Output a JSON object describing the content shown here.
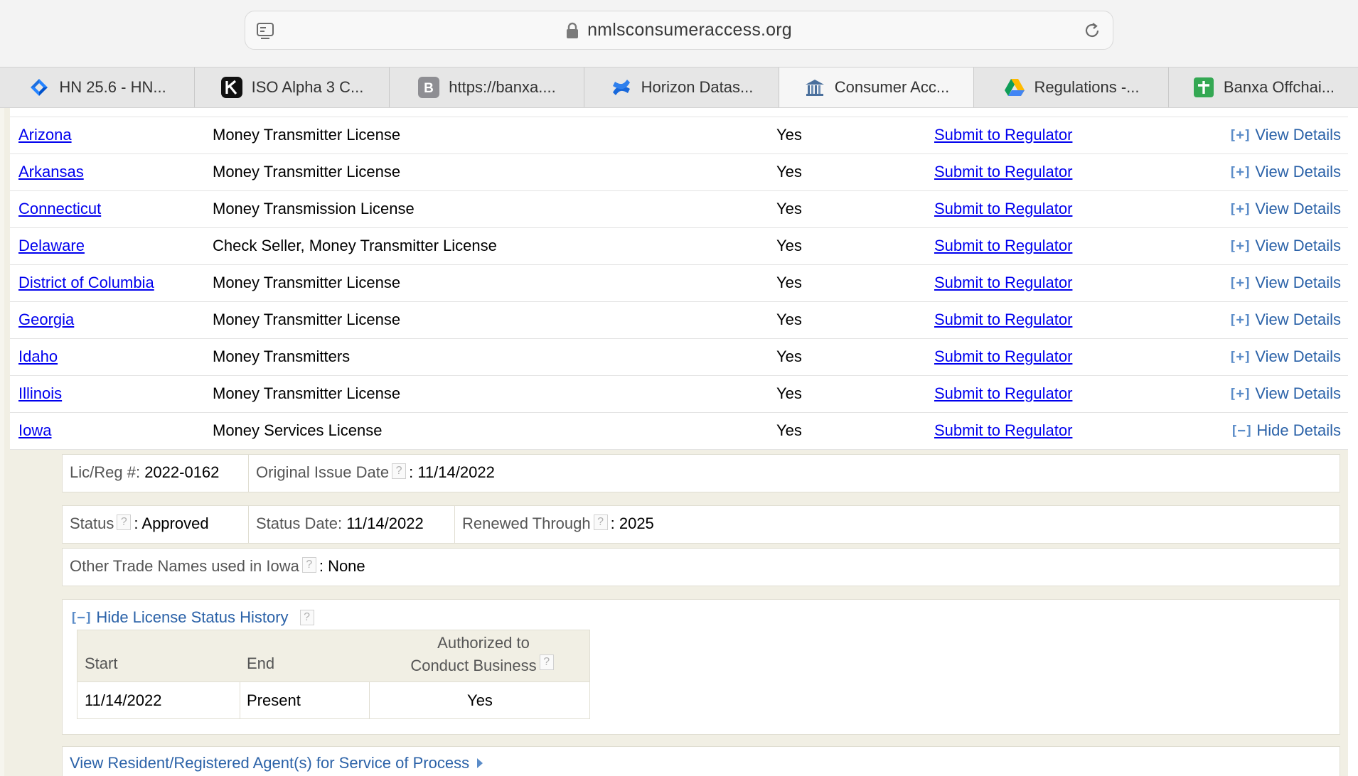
{
  "browser": {
    "url": "nmlsconsumeraccess.org",
    "tabs": [
      {
        "label": "HN 25.6 - HN...",
        "icon": "jira-icon",
        "active": false
      },
      {
        "label": "ISO Alpha 3 C...",
        "icon": "k-app-icon",
        "active": false
      },
      {
        "label": "https://banxa....",
        "icon": "b-letter-icon",
        "active": false
      },
      {
        "label": "Horizon Datas...",
        "icon": "confluence-icon",
        "active": false
      },
      {
        "label": "Consumer Acc...",
        "icon": "nmls-icon",
        "active": true
      },
      {
        "label": "Regulations -...",
        "icon": "google-drive-icon",
        "active": false
      },
      {
        "label": "Banxa Offchai...",
        "icon": "google-sheets-icon",
        "active": false
      }
    ]
  },
  "licenses": [
    {
      "state": "Arizona",
      "type": "Money Transmitter License",
      "authorized": "Yes",
      "submit": "Submit to Regulator",
      "details": "View Details",
      "expanded": false
    },
    {
      "state": "Arkansas",
      "type": "Money Transmitter License",
      "authorized": "Yes",
      "submit": "Submit to Regulator",
      "details": "View Details",
      "expanded": false
    },
    {
      "state": "Connecticut",
      "type": "Money Transmission License",
      "authorized": "Yes",
      "submit": "Submit to Regulator",
      "details": "View Details",
      "expanded": false
    },
    {
      "state": "Delaware",
      "type": "Check Seller, Money Transmitter License",
      "authorized": "Yes",
      "submit": "Submit to Regulator",
      "details": "View Details",
      "expanded": false
    },
    {
      "state": "District of Columbia",
      "type": "Money Transmitter License",
      "authorized": "Yes",
      "submit": "Submit to Regulator",
      "details": "View Details",
      "expanded": false
    },
    {
      "state": "Georgia",
      "type": "Money Transmitter License",
      "authorized": "Yes",
      "submit": "Submit to Regulator",
      "details": "View Details",
      "expanded": false
    },
    {
      "state": "Idaho",
      "type": "Money Transmitters",
      "authorized": "Yes",
      "submit": "Submit to Regulator",
      "details": "View Details",
      "expanded": false
    },
    {
      "state": "Illinois",
      "type": "Money Transmitter License",
      "authorized": "Yes",
      "submit": "Submit to Regulator",
      "details": "View Details",
      "expanded": false
    },
    {
      "state": "Iowa",
      "type": "Money Services License",
      "authorized": "Yes",
      "submit": "Submit to Regulator",
      "details": "Hide Details",
      "expanded": true
    }
  ],
  "details": {
    "lic_label": "Lic/Reg #:",
    "lic_value": "2022-0162",
    "issue_label": "Original Issue Date",
    "issue_value": "11/14/2022",
    "status_label": "Status",
    "status_value": "Approved",
    "status_date_label": "Status Date:",
    "status_date_value": "11/14/2022",
    "renewed_label": "Renewed Through",
    "renewed_value": "2025",
    "trade_label": "Other Trade Names used in Iowa",
    "trade_value": "None",
    "history_link": "Hide License Status History",
    "history": {
      "headers": {
        "start": "Start",
        "end": "End",
        "auth_line1": "Authorized to",
        "auth_line2": "Conduct Business"
      },
      "rows": [
        {
          "start": "11/14/2022",
          "end": "Present",
          "authorized": "Yes"
        }
      ]
    },
    "agent_link": "View Resident/Registered Agent(s) for Service of Process"
  }
}
